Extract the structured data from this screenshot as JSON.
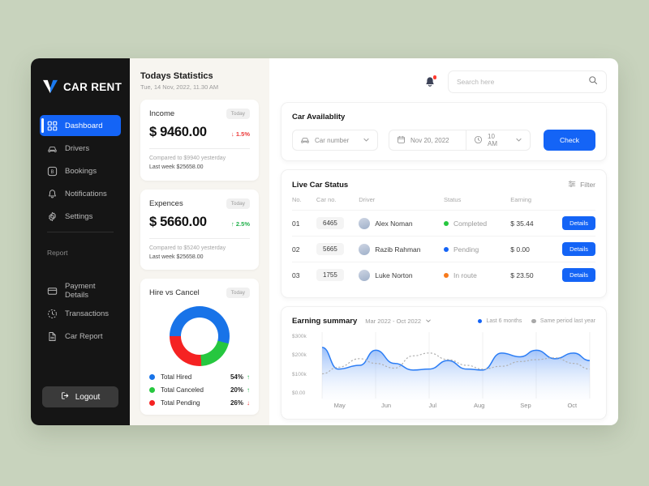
{
  "background_color": "#c8d3bd",
  "accent_color": "#1464f6",
  "sidebar": {
    "brand": "CAR RENT",
    "items": [
      {
        "label": "Dashboard",
        "icon": "grid-icon",
        "active": true
      },
      {
        "label": "Drivers",
        "icon": "car-icon",
        "active": false
      },
      {
        "label": "Bookings",
        "icon": "booking-icon",
        "active": false
      },
      {
        "label": "Notifications",
        "icon": "bell-icon",
        "active": false
      },
      {
        "label": "Settings",
        "icon": "gear-icon",
        "active": false
      }
    ],
    "section_label": "Report",
    "report_items": [
      {
        "label": "Payment Details",
        "icon": "card-icon"
      },
      {
        "label": "Transactions",
        "icon": "transaction-icon"
      },
      {
        "label": "Car Report",
        "icon": "document-icon"
      }
    ],
    "logout_label": "Logout"
  },
  "stats": {
    "title": "Todays Statistics",
    "subtitle": "Tue, 14 Nov, 2022, 11.30 AM",
    "cards": [
      {
        "title": "Income",
        "pill": "Today",
        "amount": "$ 9460.00",
        "delta": "1.5%",
        "delta_dir": "down",
        "delta_arrow": "↓",
        "note1": "Compared to $9940 yesterday",
        "note2": "Last week $25658.00"
      },
      {
        "title": "Expences",
        "pill": "Today",
        "amount": "$ 5660.00",
        "delta": "2.5%",
        "delta_dir": "up",
        "delta_arrow": "↑",
        "note1": "Compared to $5240 yesterday",
        "note2": "Last week $25658.00"
      }
    ],
    "donut": {
      "title": "Hire vs Cancel",
      "pill": "Today",
      "legend": [
        {
          "label": "Total Hired",
          "value": "54%",
          "color": "#1873e8",
          "arrow": "↑",
          "dir": "up"
        },
        {
          "label": "Total Canceled",
          "value": "20%",
          "color": "#26c73f",
          "arrow": "↑",
          "dir": "up"
        },
        {
          "label": "Total Pending",
          "value": "26%",
          "color": "#f52222",
          "arrow": "↓",
          "dir": "down"
        }
      ]
    }
  },
  "topbar": {
    "notifications_icon": "bell-icon",
    "has_unread": true,
    "search_placeholder": "Search here",
    "search_value": "",
    "search_icon": "search-icon"
  },
  "availability": {
    "title": "Car Availablity",
    "car_select": "Car number",
    "date_select": "Nov 20, 2022",
    "time_select": "10 AM",
    "check_label": "Check"
  },
  "live_status": {
    "title": "Live Car Status",
    "filter_label": "Filter",
    "columns": [
      "No.",
      "Car no.",
      "Driver",
      "Status",
      "Earning",
      ""
    ],
    "rows": [
      {
        "no": "01",
        "car_no": "6465",
        "driver": "Alex Noman",
        "status": "Completed",
        "status_color": "#26c73f",
        "earning": "$ 35.44",
        "action": "Details"
      },
      {
        "no": "02",
        "car_no": "5665",
        "driver": "Razib Rahman",
        "status": "Pending",
        "status_color": "#1464f6",
        "earning": "$ 0.00",
        "action": "Details"
      },
      {
        "no": "03",
        "car_no": "1755",
        "driver": "Luke Norton",
        "status": "In route",
        "status_color": "#f77a1c",
        "earning": "$ 23.50",
        "action": "Details"
      }
    ]
  },
  "earning": {
    "title": "Earning summary",
    "range": "Mar 2022 - Oct 2022",
    "legend": [
      {
        "label": "Last 6 months",
        "color": "#1464f6"
      },
      {
        "label": "Same period last year",
        "color": "#a8a8a8"
      }
    ]
  },
  "chart_data": {
    "type": "area",
    "title": "Earning summary",
    "xlabel": "",
    "ylabel": "",
    "ylim": [
      0,
      300000
    ],
    "ytick_labels": [
      "$0.00",
      "$100k",
      "$200k",
      "$300k"
    ],
    "ytick_values": [
      0,
      100000,
      200000,
      300000
    ],
    "categories": [
      "May",
      "Jun",
      "Jul",
      "Aug",
      "Sep",
      "Oct"
    ],
    "grid": true,
    "legend_position": "top-right",
    "series": [
      {
        "name": "Last 6 months",
        "color": "#1464f6",
        "style": "solid-area",
        "x": [
          0.0,
          0.3,
          0.7,
          1.0,
          1.35,
          1.7,
          2.0,
          2.35,
          2.7,
          3.0,
          3.35,
          3.7,
          4.0,
          4.35,
          4.7,
          5.0
        ],
        "values": [
          245000,
          130000,
          150000,
          230000,
          160000,
          125000,
          130000,
          175000,
          130000,
          125000,
          215000,
          195000,
          230000,
          185000,
          215000,
          175000
        ]
      },
      {
        "name": "Same period last year",
        "color": "#a8a8a8",
        "style": "dotted-line",
        "x": [
          0.0,
          0.3,
          0.7,
          1.0,
          1.35,
          1.7,
          2.0,
          2.35,
          2.7,
          3.0,
          3.35,
          3.7,
          4.0,
          4.35,
          4.7,
          5.0
        ],
        "values": [
          105000,
          140000,
          185000,
          160000,
          135000,
          200000,
          215000,
          180000,
          150000,
          130000,
          145000,
          170000,
          180000,
          190000,
          160000,
          130000
        ]
      }
    ]
  }
}
